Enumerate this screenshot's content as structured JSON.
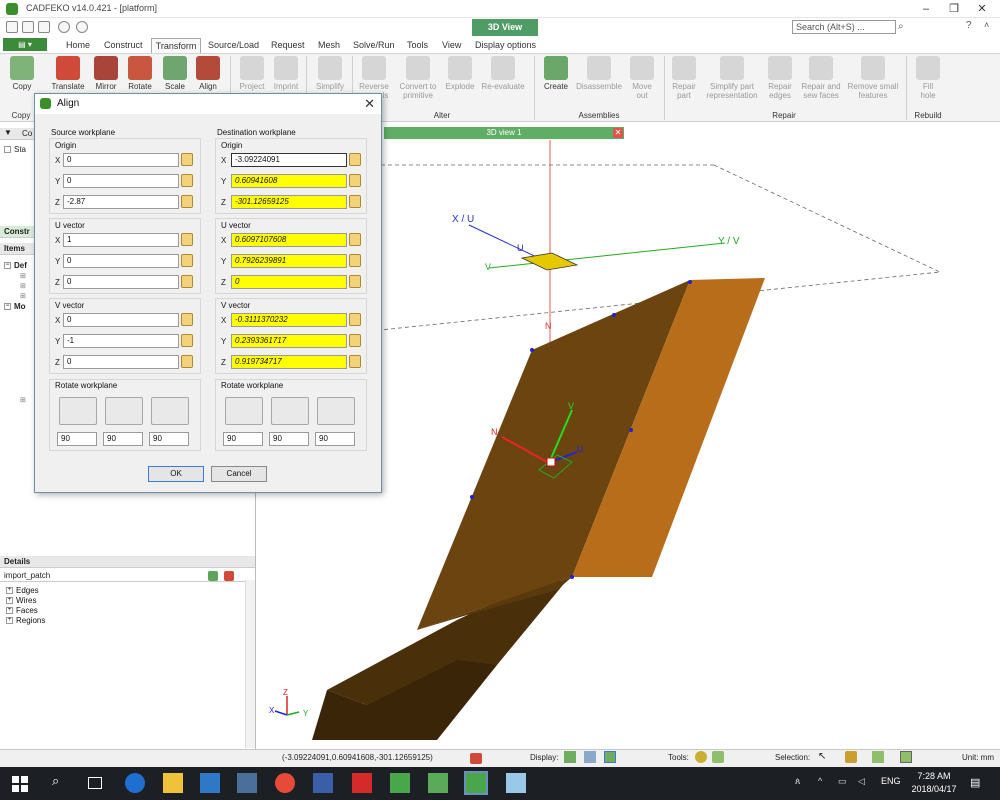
{
  "window": {
    "title": "CADFEKO v14.0.421 - [platform]"
  },
  "context_tab": "3D View",
  "search": {
    "placeholder": "Search (Alt+S) ..."
  },
  "menu_tabs": [
    "Home",
    "Construct",
    "Transform",
    "Source/Load",
    "Request",
    "Mesh",
    "Solve/Run",
    "Tools",
    "View",
    "Display options"
  ],
  "active_tab": "Transform",
  "ribbon": {
    "transform_buttons": [
      "Copy",
      "Translate",
      "Mirror",
      "Rotate",
      "Scale",
      "Align",
      "Project",
      "Imprint",
      "Simplify"
    ],
    "alter_buttons": [
      "Reverse\nnormals",
      "Convert to\nprimitive",
      "Explode",
      "Re-evaluate"
    ],
    "assembly_buttons": [
      "Create",
      "Disassemble",
      "Move\nout"
    ],
    "repair_buttons": [
      "Repair\npart",
      "Simplify part\nrepresentation",
      "Repair\nedges",
      "Repair and\nsew faces",
      "Remove small\nfeatures"
    ],
    "rebuild_buttons": [
      "Fill\nhole"
    ],
    "groups": [
      "Copy",
      "Alter",
      "Assemblies",
      "Repair",
      "Rebuild"
    ]
  },
  "left_panel": {
    "model_header": "Co",
    "model_item": "Sta",
    "construct_header": "Constr",
    "items_header": "Items",
    "tree_items": [
      "Def",
      "Mo"
    ],
    "details_header": "Details",
    "details_title": "import_patch",
    "details_items": [
      "Edges",
      "Wires",
      "Faces",
      "Regions"
    ]
  },
  "viewport": {
    "tab_label": "3D view 1",
    "labels": {
      "xu": "X / U",
      "yv": "Y / V",
      "u": "U",
      "v": "V",
      "n": "N",
      "n2": "N",
      "v2": "V",
      "u2": "U"
    },
    "triad": {
      "x": "X",
      "y": "Y",
      "z": "Z"
    }
  },
  "dialog": {
    "title": "Align",
    "source": {
      "heading": "Source workplane",
      "origin_label": "Origin",
      "origin": {
        "x": "0",
        "y": "0",
        "z": "-2.87"
      },
      "u_label": "U vector",
      "u": {
        "x": "1",
        "y": "0",
        "z": "0"
      },
      "v_label": "V vector",
      "v": {
        "x": "0",
        "y": "-1",
        "z": "0"
      },
      "rotate_label": "Rotate workplane",
      "rotate": [
        "90",
        "90",
        "90"
      ]
    },
    "dest": {
      "heading": "Destination workplane",
      "origin_label": "Origin",
      "origin": {
        "x": "-3.09224091",
        "y": "0.60941608",
        "z": "-301.12659125"
      },
      "u_label": "U vector",
      "u": {
        "x": "0.6097107608",
        "y": "0.7926239891",
        "z": "0"
      },
      "v_label": "V vector",
      "v": {
        "x": "-0.3111370232",
        "y": "0.2393361717",
        "z": "0.919734717"
      },
      "rotate_label": "Rotate workplane",
      "rotate": [
        "90",
        "90",
        "90"
      ]
    },
    "axis_labels": {
      "x": "X",
      "y": "Y",
      "z": "Z"
    },
    "ok": "OK",
    "cancel": "Cancel"
  },
  "status": {
    "coords": "(-3.09224091,0.60941608,-301.12659125)",
    "display": "Display:",
    "tools": "Tools:",
    "selection": "Selection:",
    "units": "Unit: mm"
  },
  "taskbar": {
    "lang": "ENG",
    "time": "7:28 AM",
    "date": "2018/04/17"
  },
  "colors": {
    "accent_green": "#4f9c67",
    "part_brown": "#6b4410",
    "highlight_yellow": "#ffff00"
  }
}
